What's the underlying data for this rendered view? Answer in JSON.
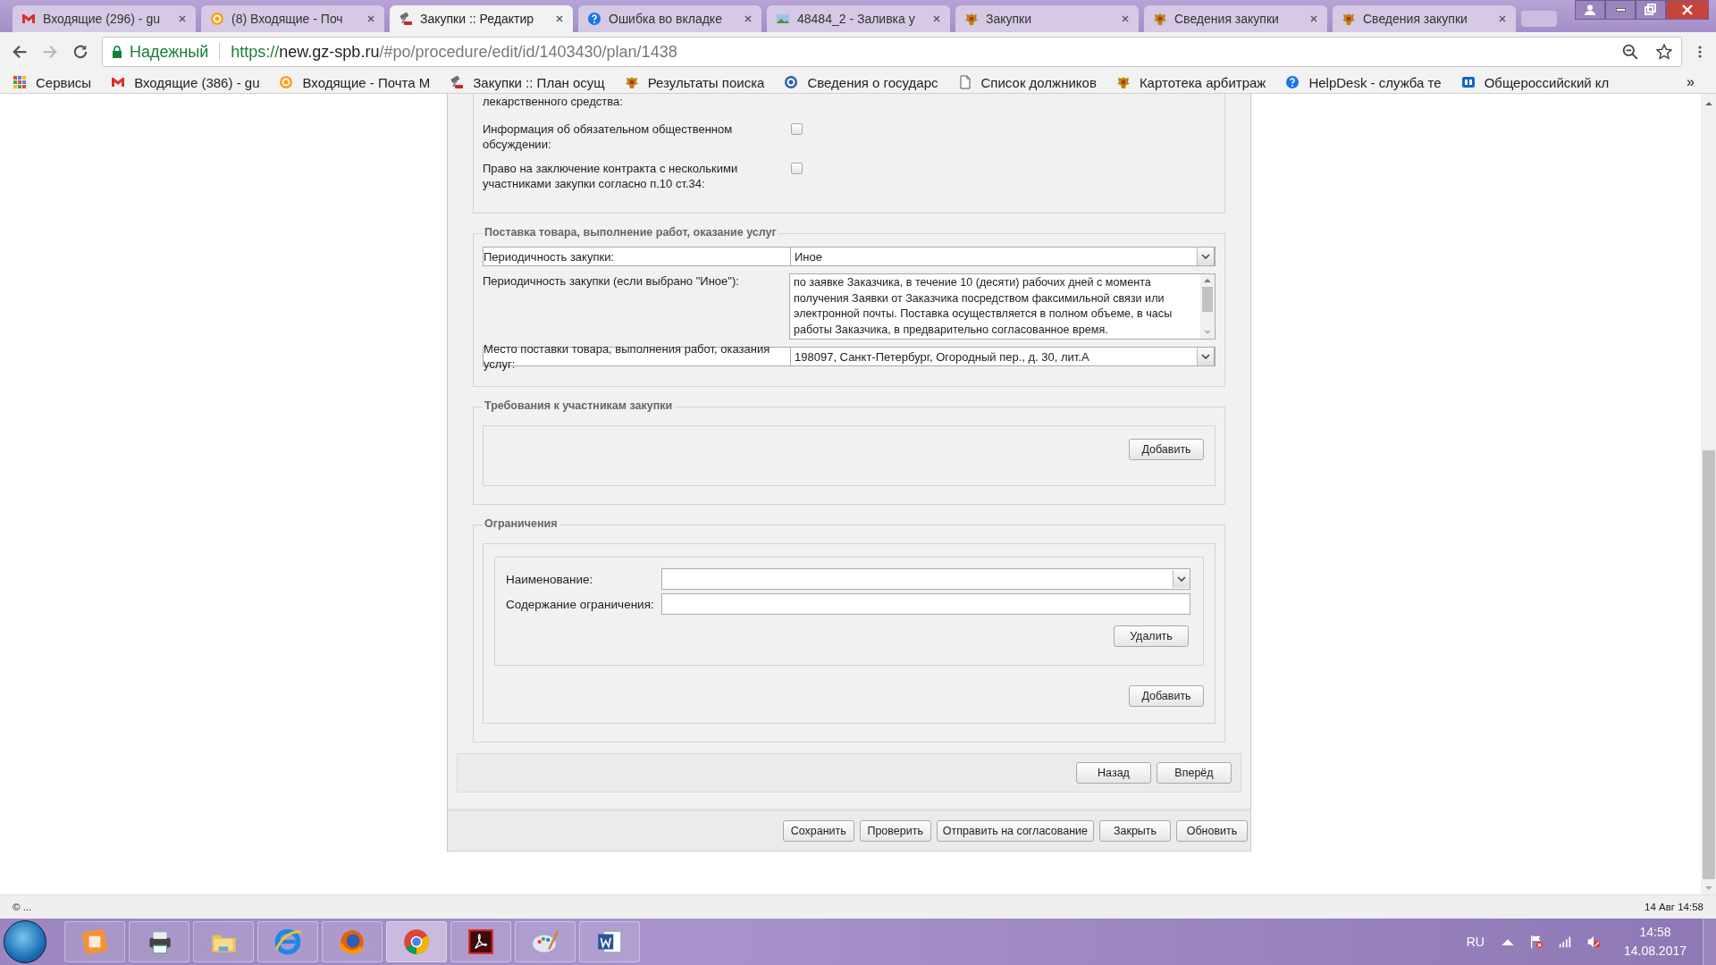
{
  "browser": {
    "tabs": [
      {
        "title": "Входящие (296) - gu",
        "kind": "mail",
        "selected": false
      },
      {
        "title": "(8) Входящие - Поч",
        "kind": "at",
        "selected": false
      },
      {
        "title": "Закупки :: Редактир",
        "kind": "gavel",
        "selected": true
      },
      {
        "title": "Ошибка во вкладке",
        "kind": "help",
        "selected": false
      },
      {
        "title": "48484_2 - Заливка у",
        "kind": "image",
        "selected": false
      },
      {
        "title": "Закупки",
        "kind": "emblem",
        "selected": false
      },
      {
        "title": "Сведения закупки",
        "kind": "emblem",
        "selected": false
      },
      {
        "title": "Сведения закупки",
        "kind": "emblem",
        "selected": false
      }
    ],
    "secure_label": "Надежный",
    "url_scheme": "https://",
    "url_host": "new.gz-spb.ru",
    "url_path": "/#po/procedure/edit/id/1403430/plan/1438",
    "bookmarks": [
      {
        "title": "Сервисы",
        "kind": "grid"
      },
      {
        "title": "Входящие (386) - gu",
        "kind": "mail"
      },
      {
        "title": "Входящие - Почта М",
        "kind": "at"
      },
      {
        "title": "Закупки :: План осущ",
        "kind": "gavel"
      },
      {
        "title": "Результаты поиска",
        "kind": "emblem"
      },
      {
        "title": "Сведения о государс",
        "kind": "seal"
      },
      {
        "title": "Список должников",
        "kind": "page"
      },
      {
        "title": "Картотека арбитраж",
        "kind": "emblem"
      },
      {
        "title": "HelpDesk - служба те",
        "kind": "help"
      },
      {
        "title": "Общероссийский кл",
        "kind": "logo"
      }
    ],
    "bookmarks_overflow": "»"
  },
  "form": {
    "sections": [
      {
        "kind": "fields",
        "rows": [
          {
            "kind": "text",
            "label": "лекарственного средства:"
          },
          {
            "kind": "checkbox",
            "label": "Информация об обязательном общественном обсуждении:",
            "checked": false
          },
          {
            "kind": "checkbox",
            "label": "Право на заключение контракта с несколькими участниками закупки согласно п.10 ст.34:",
            "checked": false
          }
        ]
      },
      {
        "kind": "fields",
        "title": "Поставка товара, выполнение работ, оказание услуг",
        "rows": [
          {
            "kind": "select",
            "label": "Периодичность закупки:",
            "value": "Иное"
          },
          {
            "kind": "textarea",
            "label": "Периодичность закупки (если выбрано \"Иное\"):",
            "value": "по заявке Заказчика, в течение 10 (десяти) рабочих дней с момента получения Заявки от Заказчика посредством факсимильной связи или электронной почты. Поставка осуществляется в полном объеме, в часы работы Заказчика, в предварительно согласованное время."
          },
          {
            "kind": "select",
            "label": "Место поставки товара, выполнения работ, оказания услуг:",
            "value": "198097, Санкт-Петербург, Огородный пер., д. 30, лит.А"
          }
        ]
      },
      {
        "kind": "list",
        "title": "Требования к участникам закупки",
        "add_button": "Добавить"
      },
      {
        "kind": "list",
        "title": "Ограничения",
        "items": [
          {
            "name_label": "Наименование:",
            "content_label": "Содержание ограничения:",
            "delete_button": "Удалить"
          }
        ],
        "add_button": "Добавить"
      }
    ],
    "nav_buttons": [
      "Назад",
      "Вперёд"
    ],
    "toolbar_buttons": [
      "Сохранить",
      "Проверить",
      "Отправить на согласование",
      "Закрыть",
      "Обновить"
    ]
  },
  "footer": {
    "left": "© ...",
    "right": "14 Авг 14:58"
  },
  "taskbar": {
    "apps": [
      {
        "kind": "tile",
        "selected": false
      },
      {
        "kind": "printer",
        "selected": false
      },
      {
        "kind": "folder",
        "selected": false
      },
      {
        "kind": "ie",
        "selected": false
      },
      {
        "kind": "firefox",
        "selected": false
      },
      {
        "kind": "chrome",
        "selected": true
      },
      {
        "kind": "pdf",
        "selected": false
      },
      {
        "kind": "paint",
        "selected": false
      },
      {
        "kind": "word",
        "selected": false
      }
    ],
    "language": "RU",
    "time": "14:58",
    "date": "14.08.2017"
  }
}
